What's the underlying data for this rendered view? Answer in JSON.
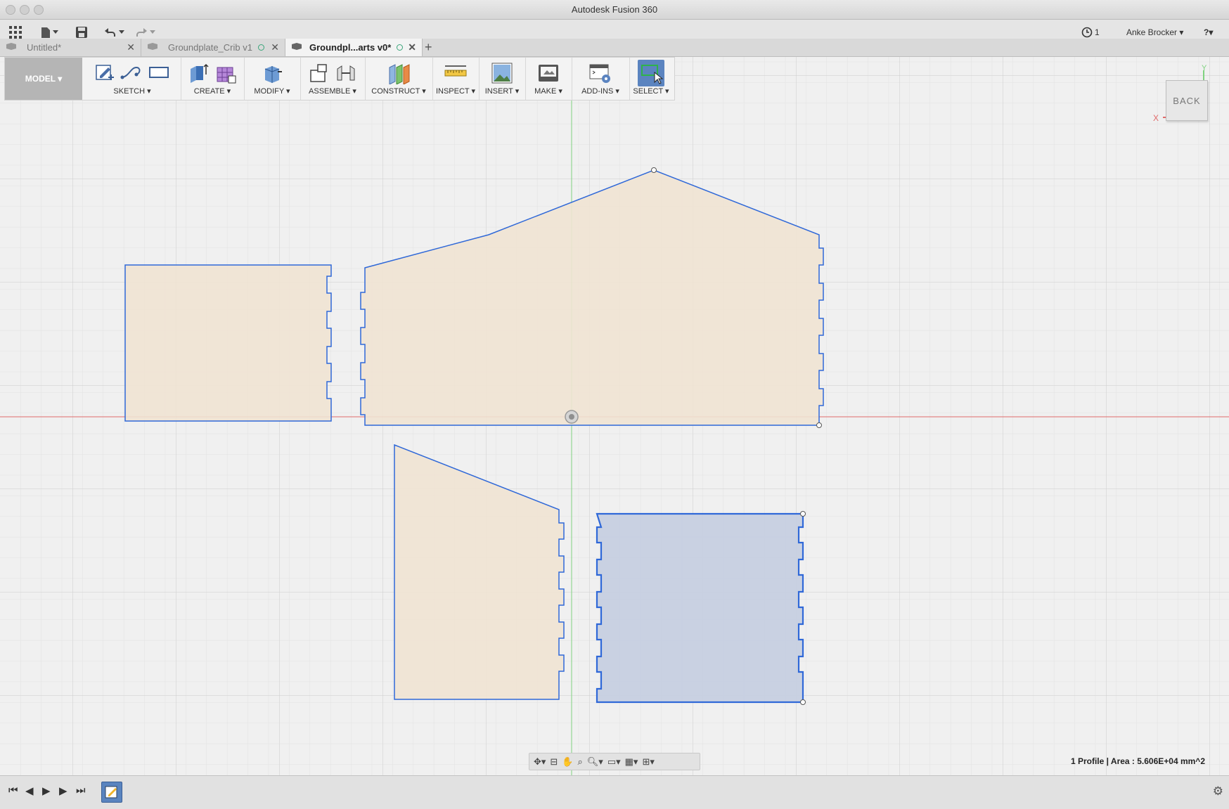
{
  "window": {
    "title": "Autodesk Fusion 360"
  },
  "appbar": {
    "jobs_count": "1",
    "user_name": "Anke Brocker ▾",
    "help_label": "?▾"
  },
  "tabs": [
    {
      "label": "Untitled*",
      "active": false
    },
    {
      "label": "Groundplate_Crib v1",
      "active": false
    },
    {
      "label": "Groundpl...arts v0*",
      "active": true
    }
  ],
  "toolbar": {
    "workspace": "MODEL ▾",
    "groups": [
      {
        "label": "SKETCH ▾"
      },
      {
        "label": "CREATE ▾"
      },
      {
        "label": "MODIFY ▾"
      },
      {
        "label": "ASSEMBLE ▾"
      },
      {
        "label": "CONSTRUCT ▾"
      },
      {
        "label": "INSPECT ▾"
      },
      {
        "label": "INSERT ▾"
      },
      {
        "label": "MAKE ▾"
      },
      {
        "label": "ADD-INS ▾"
      },
      {
        "label": "SELECT ▾"
      }
    ]
  },
  "viewcube": {
    "face": "BACK",
    "axis_x": "X",
    "axis_y": "Y"
  },
  "status": {
    "text": "1 Profile | Area : 5.606E+04 mm^2"
  },
  "colors": {
    "sketch_line": "#2f68d8",
    "profile_fill": "#efe3d3",
    "selected_fill": "#c6cfe0",
    "x_axis": "#e06a6a",
    "y_axis": "#7fd27f",
    "grid_minor": "#e2e2e2",
    "grid_major": "#cfcfcf"
  }
}
